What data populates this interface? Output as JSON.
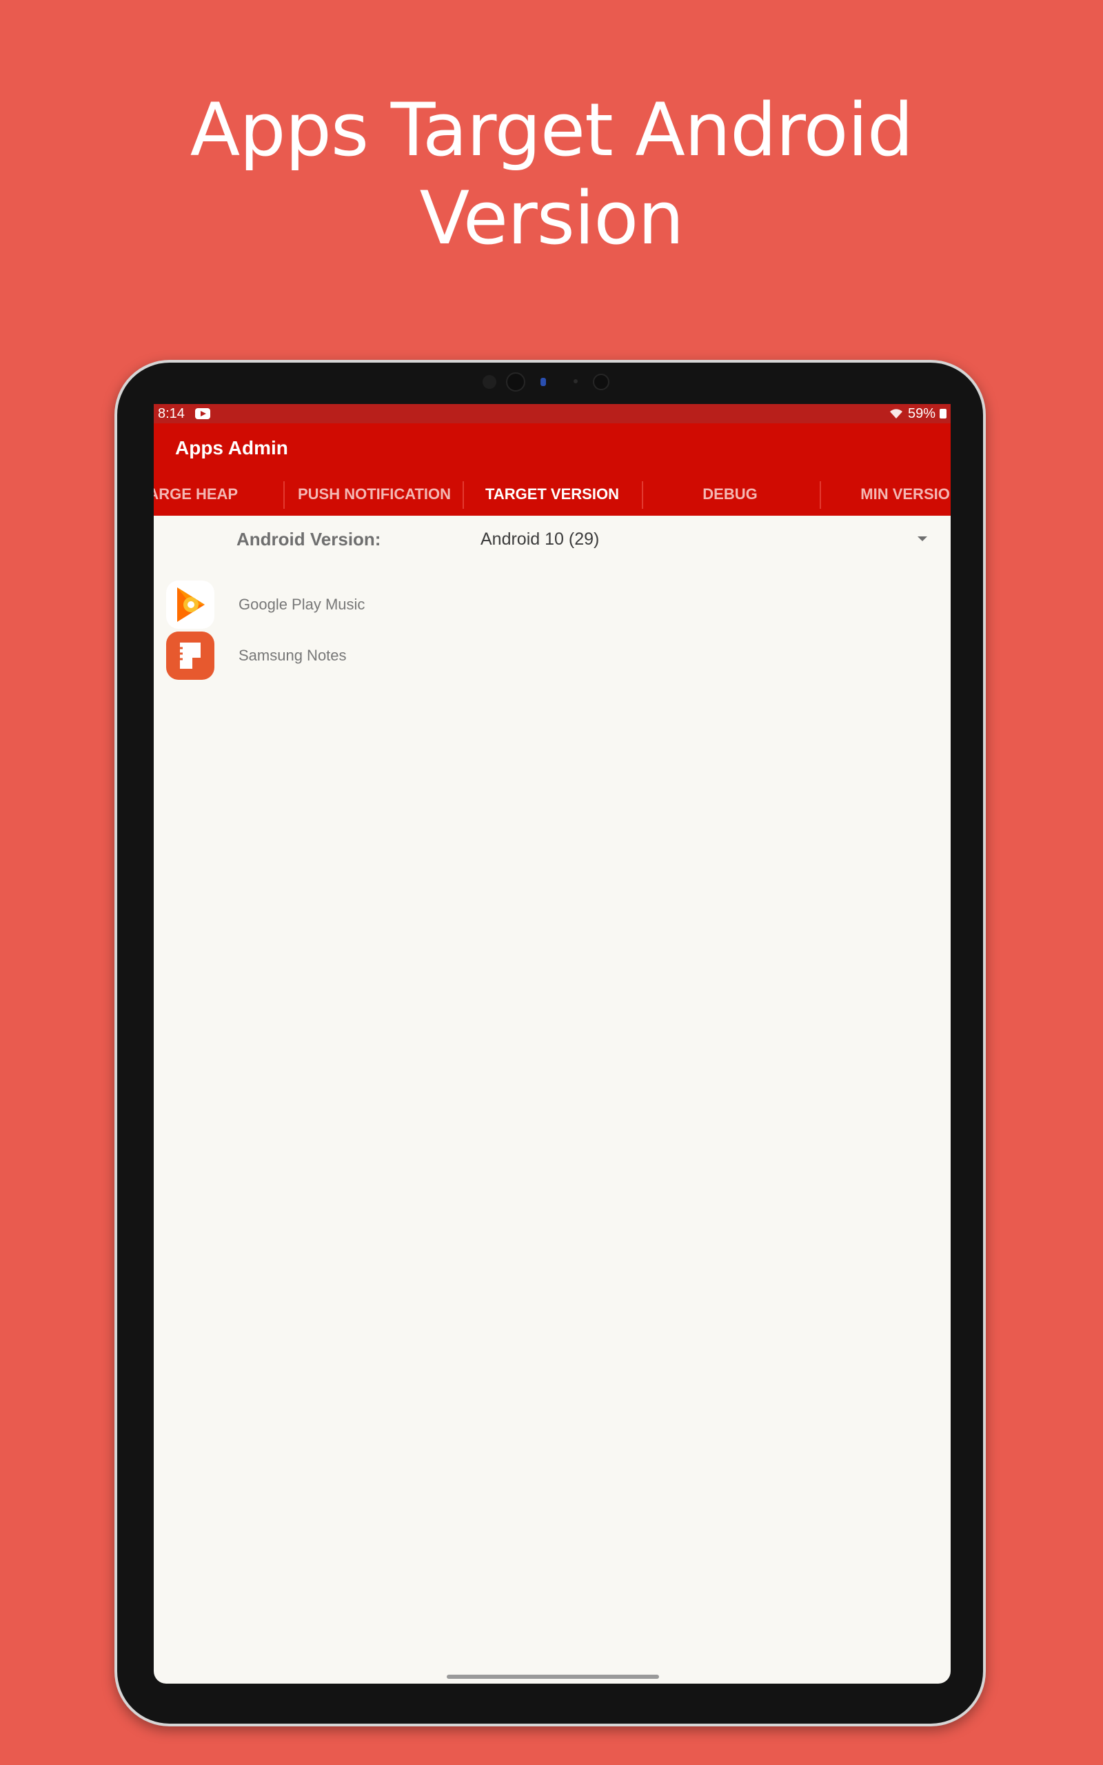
{
  "promo": {
    "headline_line1": "Apps Target Android",
    "headline_line2": "Version",
    "background_color": "#e95b4f"
  },
  "status_bar": {
    "time": "8:14",
    "battery": "59%",
    "icons": [
      "youtube-icon",
      "wifi-icon",
      "battery-icon"
    ]
  },
  "toolbar": {
    "title": "Apps Admin",
    "color": "#d00b02"
  },
  "tabs": [
    {
      "label": "LARGE HEAP",
      "active": false
    },
    {
      "label": "PUSH NOTIFICATION",
      "active": false
    },
    {
      "label": "TARGET VERSION",
      "active": true
    },
    {
      "label": "DEBUG",
      "active": false
    },
    {
      "label": "MIN VERSION",
      "active": false
    }
  ],
  "filter": {
    "label": "Android Version:",
    "selected": "Android 10 (29)"
  },
  "apps": [
    {
      "name": "Google Play Music",
      "icon": "google-play-music-icon"
    },
    {
      "name": "Samsung Notes",
      "icon": "samsung-notes-icon"
    }
  ]
}
